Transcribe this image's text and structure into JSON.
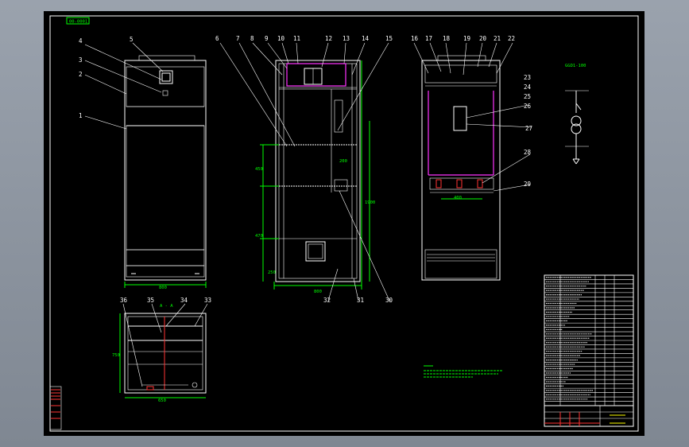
{
  "sheet_tag": "00-0001",
  "callouts": {
    "c1": "1",
    "c2": "2",
    "c3": "3",
    "c4": "4",
    "c5": "5",
    "c6": "6",
    "c7": "7",
    "c8": "8",
    "c9": "9",
    "c10": "10",
    "c11": "11",
    "c12": "12",
    "c13": "13",
    "c14": "14",
    "c15": "15",
    "c16": "16",
    "c17": "17",
    "c18": "18",
    "c19": "19",
    "c20": "20",
    "c21": "21",
    "c22": "22",
    "c23": "23",
    "c24": "24",
    "c25": "25",
    "c26": "26",
    "c27": "27",
    "c28": "28",
    "c29": "29",
    "c30": "30",
    "c31": "31",
    "c32": "32",
    "c33": "33",
    "c34": "34",
    "c35": "35",
    "c36": "36"
  },
  "dimensions": {
    "front_width": "800",
    "side_width": "800",
    "side_height": "1900",
    "shelf_upper": "450",
    "shelf_lower": "470",
    "base": "250",
    "bracket": "200",
    "rear_span": "400",
    "plan_width": "650",
    "plan_depth": "750"
  },
  "section_label": "A - A",
  "schematic_caption": "GGD1-100"
}
